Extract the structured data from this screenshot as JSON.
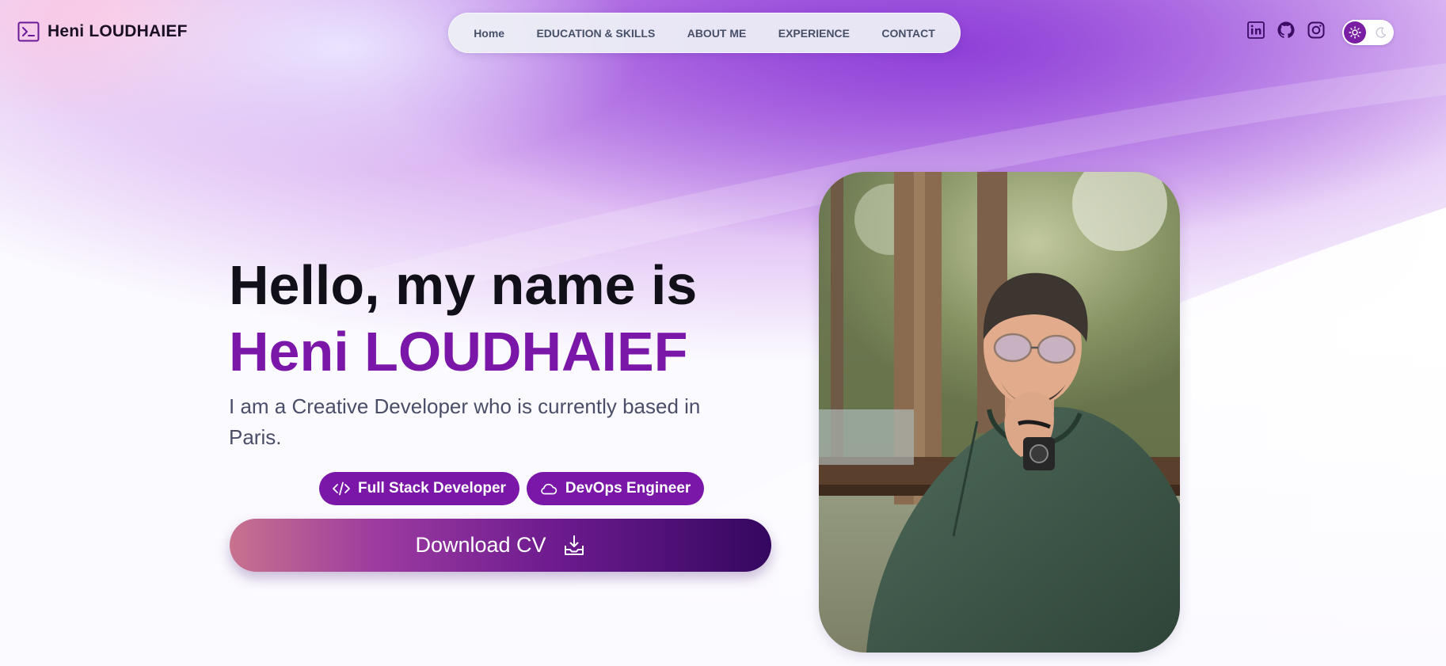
{
  "brand": {
    "name": "Heni LOUDHAIEF",
    "icon": "terminal-icon"
  },
  "nav": {
    "items": [
      {
        "label": "Home"
      },
      {
        "label": "EDUCATION & SKILLS"
      },
      {
        "label": "ABOUT ME"
      },
      {
        "label": "EXPERIENCE"
      },
      {
        "label": "CONTACT"
      }
    ]
  },
  "socials": [
    {
      "name": "linkedin",
      "icon": "linkedin-icon"
    },
    {
      "name": "github",
      "icon": "github-icon"
    },
    {
      "name": "instagram",
      "icon": "instagram-icon"
    }
  ],
  "theme_toggle": {
    "active": "light",
    "icons": [
      "sun-icon",
      "moon-icon"
    ]
  },
  "hero": {
    "greeting": "Hello, my name is",
    "name": "Heni LOUDHAIEF",
    "description": "I am a Creative Developer who is currently based in Paris.",
    "roles": [
      {
        "label": "Full Stack Developer",
        "icon": "code-icon"
      },
      {
        "label": "DevOps Engineer",
        "icon": "cloud-icon"
      }
    ],
    "cta": {
      "label": "Download CV",
      "icon": "download-icon"
    }
  },
  "colors": {
    "accent": "#7a16a8",
    "heading": "#111018",
    "body_text": "#4a4e68",
    "nav_text": "#475068"
  }
}
